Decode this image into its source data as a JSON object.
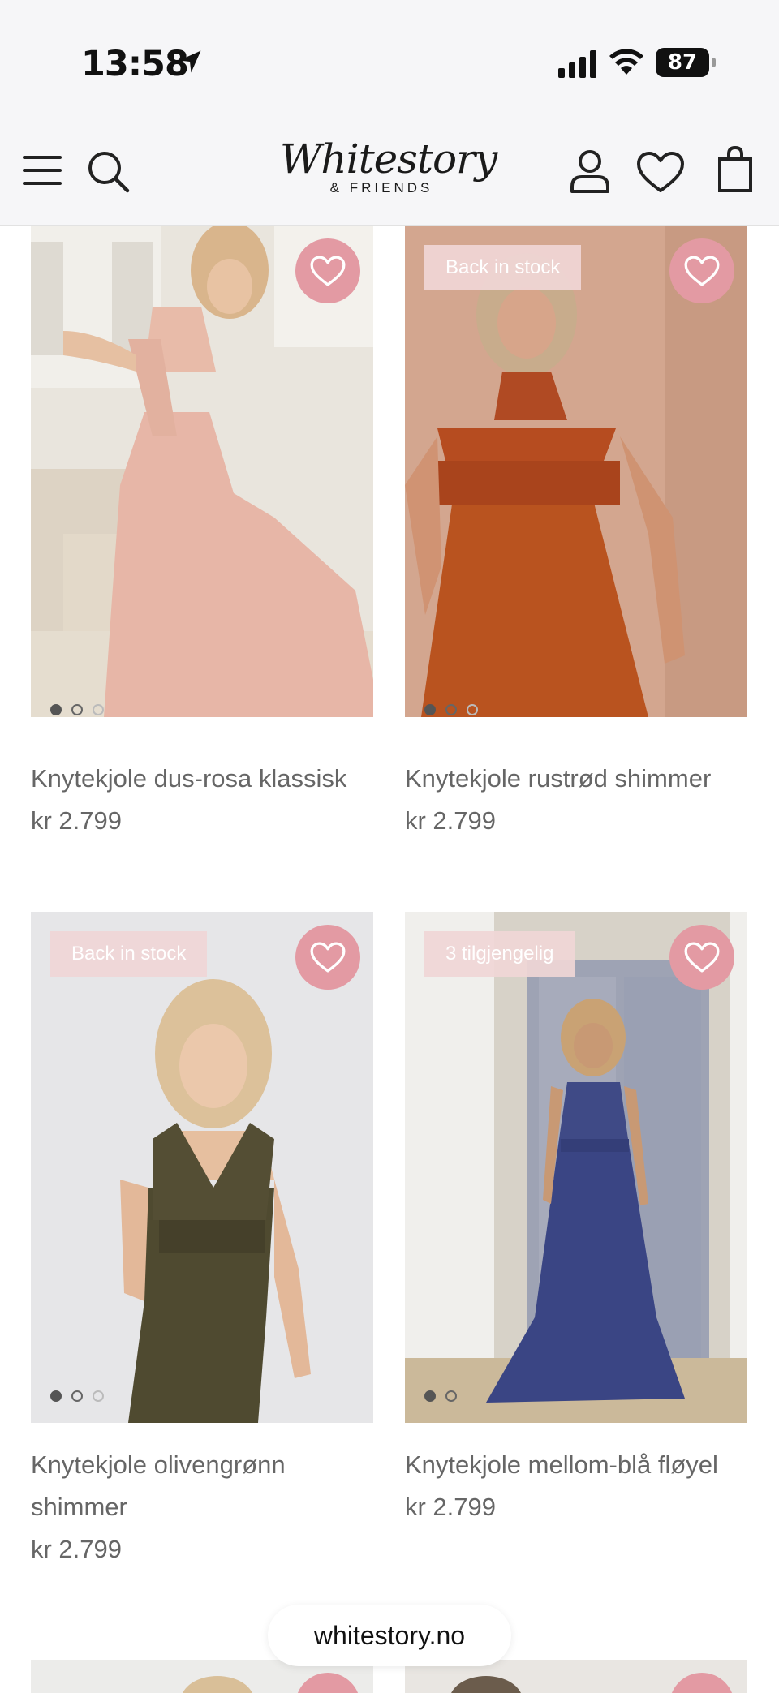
{
  "status_bar": {
    "time": "13:58",
    "battery": "87"
  },
  "header": {
    "logo_script": "Whitestory",
    "logo_sub": "& FRIENDS"
  },
  "products": [
    {
      "name": "Knytekjole dus-rosa klassisk",
      "price": "kr 2.799",
      "badge": "",
      "dots": 3
    },
    {
      "name": "Knytekjole rustrød shimmer",
      "price": "kr 2.799",
      "badge": "Back in stock",
      "dots": 3
    },
    {
      "name": "Knytekjole olivengrønn shimmer",
      "price": "kr 2.799",
      "badge": "Back in stock",
      "dots": 3
    },
    {
      "name": "Knytekjole mellom-blå fløyel",
      "price": "kr 2.799",
      "badge": "3 tilgjengelig",
      "dots": 2
    }
  ],
  "browser": {
    "url": "whitestory.no"
  },
  "colors": {
    "wishlist_bg": "#e39aa3",
    "badge_bg": "#f0d6d6",
    "header_bg": "#f6f6f8"
  }
}
